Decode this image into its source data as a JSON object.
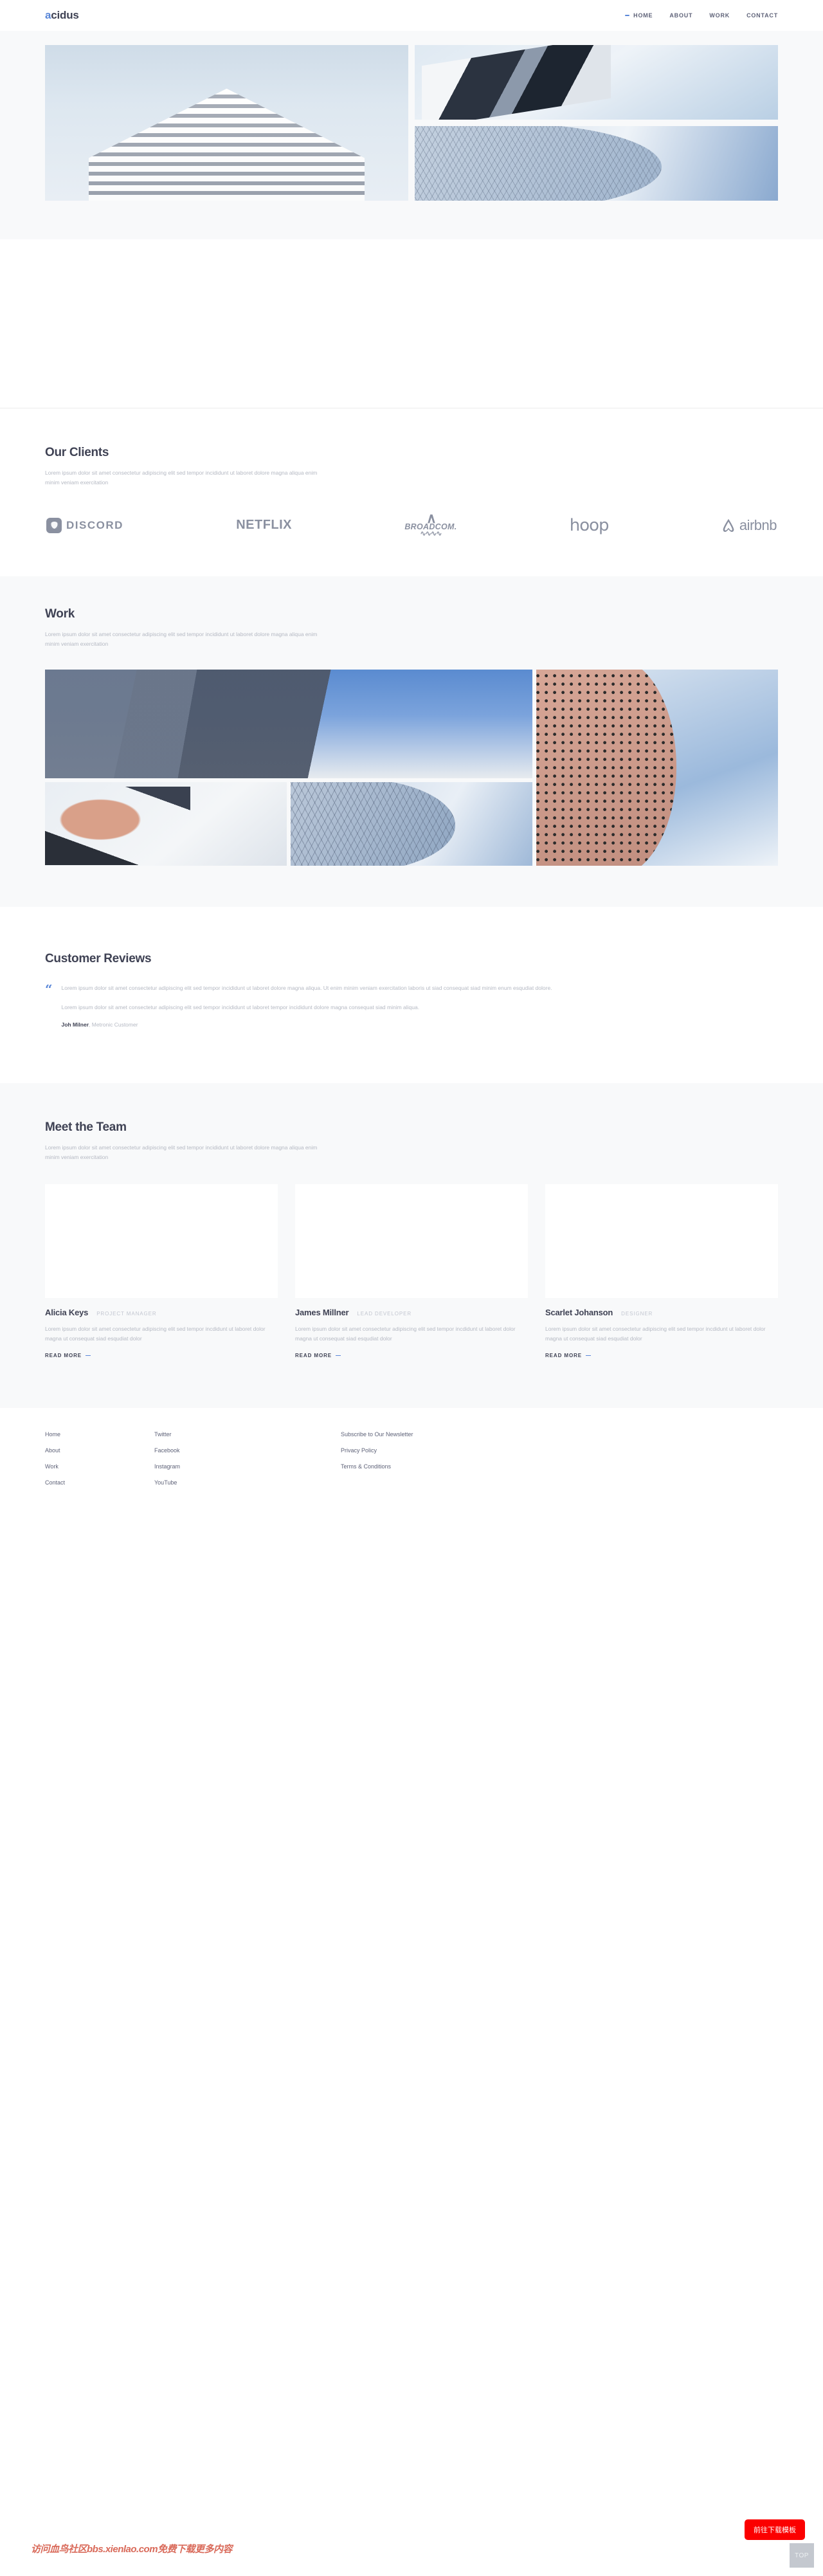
{
  "brand": {
    "logo_first": "a",
    "logo_rest": "cidus",
    "accent_color": "#5a87d8",
    "text_color": "#3f4254"
  },
  "nav": {
    "items": [
      {
        "label": "HOME",
        "active": true
      },
      {
        "label": "ABOUT",
        "active": false
      },
      {
        "label": "WORK",
        "active": false
      },
      {
        "label": "CONTACT",
        "active": false
      }
    ]
  },
  "hero": {
    "images": [
      {
        "name": "hero-image-tower",
        "alt": "concrete tower seen from below"
      },
      {
        "name": "hero-image-canopy",
        "alt": "angular white canopy against sky"
      },
      {
        "name": "hero-image-dome",
        "alt": "hexagonal tiled dome facade"
      }
    ]
  },
  "clients": {
    "title": "Our Clients",
    "subtitle": "Lorem ipsum dolor sit amet consectetur adipiscing elit sed tempor incididunt ut laboret dolore magna aliqua enim minim veniam exercitation",
    "logos": [
      {
        "name": "discord-logo",
        "label": "DISCORD"
      },
      {
        "name": "netflix-logo",
        "label": "NETFLIX"
      },
      {
        "name": "broadcom-logo",
        "label": "BROADCOM."
      },
      {
        "name": "hoop-logo",
        "label": "hoop"
      },
      {
        "name": "airbnb-logo",
        "label": "airbnb"
      }
    ]
  },
  "work": {
    "title": "Work",
    "subtitle": "Lorem ipsum dolor sit amet consectetur adipiscing elit sed tempor incididunt ut laboret dolore magna aliqua enim minim veniam exercitation",
    "images": [
      {
        "name": "work-image-plaza",
        "alt": "two concrete buildings and blue sky"
      },
      {
        "name": "work-image-perforated",
        "alt": "perforated curved pink facade"
      },
      {
        "name": "work-image-worker",
        "alt": "worker installing fixture"
      },
      {
        "name": "work-image-hex-dome",
        "alt": "hexagonal dome close up"
      },
      {
        "name": "work-image-shoe",
        "alt": "person resting feet on white chair"
      }
    ]
  },
  "reviews": {
    "title": "Customer Reviews",
    "quote_glyph": "“",
    "paragraphs": [
      "Lorem ipsum dolor sit amet consectetur adipiscing elit sed tempor incididunt ut laboret dolore magna aliqua. Ut enim minim veniam exercitation laboris ut siad consequat siad minim enum esqudiat dolore.",
      "Lorem ipsum dolor sit amet consectetur adipiscing elit sed tempor incididunt ut laboret tempor incididunt dolore magna consequat siad minim aliqua."
    ],
    "author_name": "Joh Milner",
    "author_title": ", Metronic Customer"
  },
  "team": {
    "title": "Meet the Team",
    "subtitle": "Lorem ipsum dolor sit amet consectetur adipiscing elit sed tempor incididunt ut laboret dolore magna aliqua enim minim veniam exercitation",
    "read_more_label": "READ MORE",
    "members": [
      {
        "name": "Alicia Keys",
        "role": "PROJECT MANAGER",
        "desc": "Lorem ipsum dolor sit amet consectetur adipiscing elit sed tempor incdidunt ut laboret dolor magna ut consequat siad esqudiat dolor"
      },
      {
        "name": "James Millner",
        "role": "LEAD DEVELOPER",
        "desc": "Lorem ipsum dolor sit amet consectetur adipiscing elit sed tempor incdidunt ut laboret dolor magna ut consequat siad esqudiat dolor"
      },
      {
        "name": "Scarlet Johanson",
        "role": "DESIGNER",
        "desc": "Lorem ipsum dolor sit amet consectetur adipiscing elit sed tempor incdidunt ut laboret dolor magna ut consequat siad esqudiat dolor"
      }
    ]
  },
  "footer": {
    "col1": [
      "Home",
      "About",
      "Work",
      "Contact"
    ],
    "col2": [
      "Twitter",
      "Facebook",
      "Instagram",
      "YouTube"
    ],
    "col3": [
      "Subscribe to Our Newsletter",
      "Privacy Policy",
      "Terms & Conditions"
    ]
  },
  "overlay": {
    "watermark": "访问血鸟社区bbs.xienlao.com免费下载更多内容",
    "download_button": "前往下载模板",
    "top_button": "TOP",
    "download_color": "#fb0000"
  }
}
